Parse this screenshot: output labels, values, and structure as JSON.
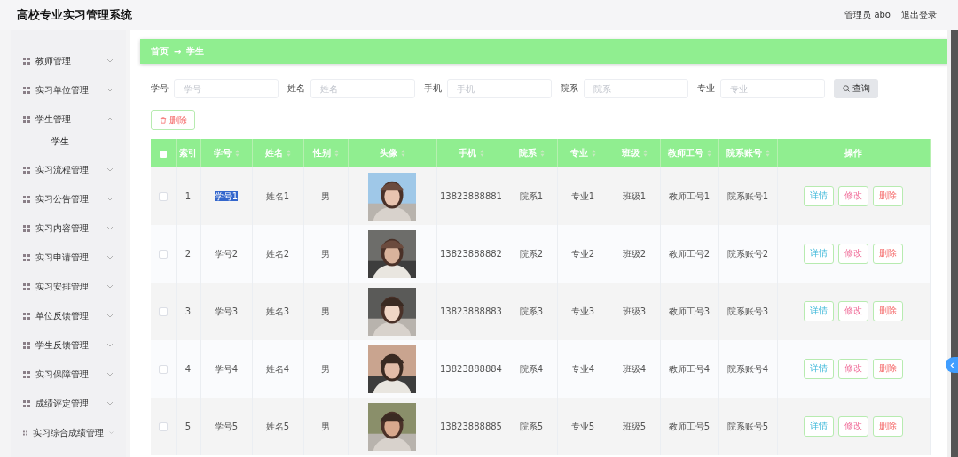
{
  "header": {
    "title": "高校专业实习管理系统",
    "user": "管理员 abo",
    "logout": "退出登录"
  },
  "sidebar": {
    "items": [
      {
        "label": "教师管理",
        "expanded": false
      },
      {
        "label": "实习单位管理",
        "expanded": false
      },
      {
        "label": "学生管理",
        "expanded": true,
        "children": [
          {
            "label": "学生"
          }
        ]
      },
      {
        "label": "实习流程管理",
        "expanded": false
      },
      {
        "label": "实习公告管理",
        "expanded": false
      },
      {
        "label": "实习内容管理",
        "expanded": false
      },
      {
        "label": "实习申请管理",
        "expanded": false
      },
      {
        "label": "实习安排管理",
        "expanded": false
      },
      {
        "label": "单位反馈管理",
        "expanded": false
      },
      {
        "label": "学生反馈管理",
        "expanded": false
      },
      {
        "label": "实习保障管理",
        "expanded": false
      },
      {
        "label": "成绩评定管理",
        "expanded": false
      },
      {
        "label": "实习综合成绩管理",
        "expanded": false
      }
    ]
  },
  "breadcrumb": [
    "首页",
    "→",
    "学生"
  ],
  "filters": [
    {
      "label": "学号",
      "placeholder": "学号"
    },
    {
      "label": "姓名",
      "placeholder": "姓名"
    },
    {
      "label": "手机",
      "placeholder": "手机"
    },
    {
      "label": "院系",
      "placeholder": "院系"
    },
    {
      "label": "专业",
      "placeholder": "专业"
    }
  ],
  "search_button": "查询",
  "delete_button": "删除",
  "table": {
    "select_all": {
      "checked": false
    },
    "columns": [
      {
        "label": "索引",
        "sortable": false
      },
      {
        "label": "学号",
        "sortable": true
      },
      {
        "label": "姓名",
        "sortable": true
      },
      {
        "label": "性别",
        "sortable": true
      },
      {
        "label": "头像",
        "sortable": true
      },
      {
        "label": "手机",
        "sortable": true
      },
      {
        "label": "院系",
        "sortable": true
      },
      {
        "label": "专业",
        "sortable": true
      },
      {
        "label": "班级",
        "sortable": true
      },
      {
        "label": "教师工号",
        "sortable": true
      },
      {
        "label": "院系账号",
        "sortable": true
      },
      {
        "label": "操作",
        "sortable": false
      }
    ],
    "rows": [
      {
        "checked": false,
        "cells": [
          "1",
          "学号1",
          "姓名1",
          "男",
          {
            "kind": "picture"
          },
          "13823888881",
          "院系1",
          "专业1",
          "班级1",
          "教师工号1",
          "院系账号1"
        ],
        "highlighted": true,
        "actions": [
          "详情",
          "修改",
          "删除"
        ]
      },
      {
        "checked": false,
        "cells": [
          "2",
          "学号2",
          "姓名2",
          "男",
          {
            "kind": "picture"
          },
          "13823888882",
          "院系2",
          "专业2",
          "班级2",
          "教师工号2",
          "院系账号2"
        ],
        "highlighted": false,
        "actions": [
          "详情",
          "修改",
          "删除"
        ]
      },
      {
        "checked": false,
        "cells": [
          "3",
          "学号3",
          "姓名3",
          "男",
          {
            "kind": "picture"
          },
          "13823888883",
          "院系3",
          "专业3",
          "班级3",
          "教师工号3",
          "院系账号3"
        ],
        "highlighted": false,
        "actions": [
          "详情",
          "修改",
          "删除"
        ]
      },
      {
        "checked": false,
        "cells": [
          "4",
          "学号4",
          "姓名4",
          "男",
          {
            "kind": "picture"
          },
          "13823888884",
          "院系4",
          "专业4",
          "班级4",
          "教师工号4",
          "院系账号4"
        ],
        "highlighted": false,
        "actions": [
          "详情",
          "修改",
          "删除"
        ]
      },
      {
        "checked": false,
        "cells": [
          "5",
          "学号5",
          "姓名5",
          "男",
          {
            "kind": "picture"
          },
          "13823888885",
          "院系5",
          "专业5",
          "班级5",
          "教师工号5",
          "院系账号5"
        ],
        "highlighted": false,
        "actions": [
          "详情",
          "修改",
          "删除"
        ]
      }
    ]
  }
}
